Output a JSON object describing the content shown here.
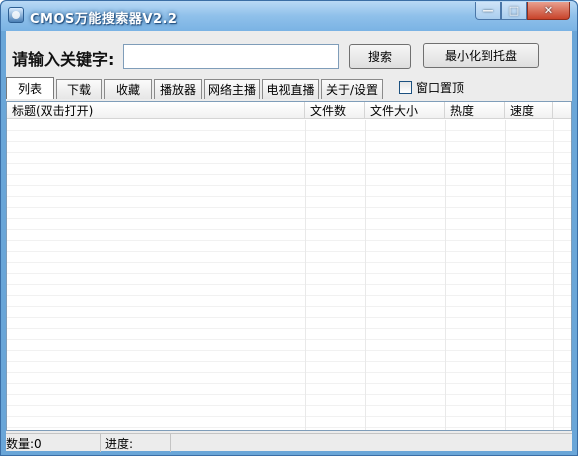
{
  "window": {
    "title": "CMOS万能搜索器V2.2",
    "buttons": {
      "minimize": "—",
      "maximize": "□",
      "close": "✕"
    }
  },
  "search": {
    "label": "请输入关键字:",
    "value": "",
    "search_button": "搜索",
    "tray_button": "最小化到托盘"
  },
  "tabs": [
    {
      "label": "列表",
      "active": true
    },
    {
      "label": "下载"
    },
    {
      "label": "收藏"
    },
    {
      "label": "播放器"
    },
    {
      "label": "网络主播"
    },
    {
      "label": "电视直播"
    },
    {
      "label": "关于/设置"
    }
  ],
  "stay_on_top": {
    "label": "窗口置顶",
    "checked": false
  },
  "table": {
    "columns": [
      "标题(双击打开)",
      "文件数",
      "文件大小",
      "热度",
      "速度",
      ""
    ]
  },
  "status": {
    "count": "数量:0",
    "progress": "进度:"
  }
}
